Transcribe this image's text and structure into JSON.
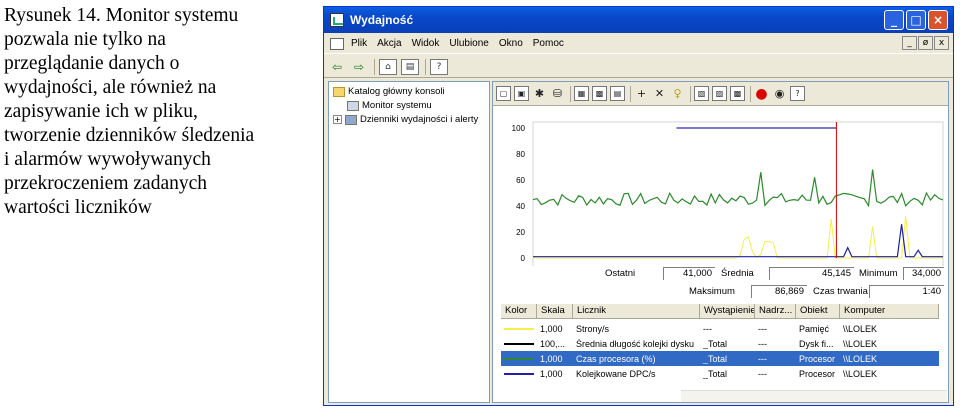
{
  "caption": {
    "lines": [
      "Rysunek 14. Monitor systemu",
      "pozwala nie tylko na",
      "przeglądanie danych o",
      "wydajności, ale również na",
      "zapisywanie ich w pliku,",
      "tworzenie dzienników śledzenia",
      "i alarmów wywoływanych",
      "przekroczeniem zadanych",
      "wartości liczników"
    ]
  },
  "window": {
    "title": "Wydajność",
    "buttons": [
      "_",
      "□",
      "×"
    ],
    "mdi_buttons": [
      "_",
      "ø",
      "x"
    ]
  },
  "menu": [
    "Plik",
    "Akcja",
    "Widok",
    "Ulubione",
    "Okno",
    "Pomoc"
  ],
  "toolbar": [
    "⇦",
    "⇨",
    "⌂",
    "▤",
    "?"
  ],
  "tree": {
    "root": "Katalog główny konsoli",
    "items": [
      "Monitor systemu",
      "Dzienniki wydajności i alerty"
    ],
    "expander": "+"
  },
  "chart_toolbar": [
    "▢",
    "▣",
    "✱",
    "⛁",
    "▦",
    "▩",
    "▤",
    "+",
    "✕",
    "♀",
    "▧",
    "▨",
    "▩",
    "●",
    "◉",
    "?"
  ],
  "chart_data": {
    "type": "line",
    "ylim": [
      0,
      100
    ],
    "yticks": [
      "100",
      "80",
      "60",
      "40",
      "20",
      "0"
    ],
    "series": [
      {
        "name": "Strony/s",
        "color": "#f5ef4a"
      },
      {
        "name": "Średnia długość kolejki dysku",
        "color": "#000000"
      },
      {
        "name": "Czas procesora (%)",
        "color": "#2c8a2c"
      },
      {
        "name": "Kolejkowane DPC/s",
        "color": "#2020a8"
      }
    ],
    "time_marker": 0.74
  },
  "stats": {
    "last_label": "Ostatni",
    "last_value": "41,000",
    "avg_label": "Średnia",
    "avg_value": "45,145",
    "min_label": "Minimum",
    "min_value": "34,000",
    "max_label": "Maksimum",
    "max_value": "86,869",
    "dur_label": "Czas trwania",
    "dur_value": "1:40"
  },
  "list": {
    "headers": [
      "Kolor",
      "Skala",
      "Licznik",
      "Wystąpienie",
      "Nadrz...",
      "Obiekt",
      "Komputer"
    ],
    "rows": [
      {
        "color": "#f5ef4a",
        "scale": "1,000",
        "counter": "Strony/s",
        "instance": "---",
        "parent": "---",
        "object": "Pamięć",
        "computer": "\\\\LOLEK",
        "selected": false
      },
      {
        "color": "#000000",
        "scale": "100,...",
        "counter": "Średnia długość kolejki dysku",
        "instance": "_Total",
        "parent": "---",
        "object": "Dysk fi...",
        "computer": "\\\\LOLEK",
        "selected": false
      },
      {
        "color": "#2c8a2c",
        "scale": "1,000",
        "counter": "Czas procesora (%)",
        "instance": "_Total",
        "parent": "---",
        "object": "Procesor",
        "computer": "\\\\LOLEK",
        "selected": true
      },
      {
        "color": "#2020a8",
        "scale": "1,000",
        "counter": "Kolejkowane DPC/s",
        "instance": "_Total",
        "parent": "---",
        "object": "Procesor",
        "computer": "\\\\LOLEK",
        "selected": false
      }
    ]
  }
}
